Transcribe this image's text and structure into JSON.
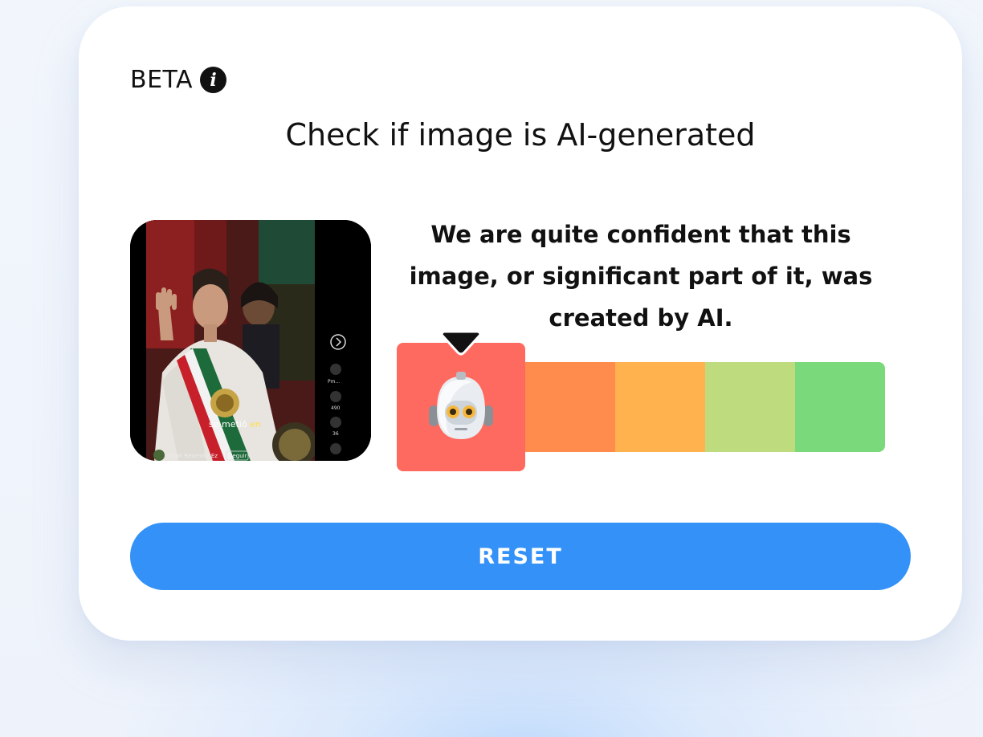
{
  "header": {
    "badge": "BETA",
    "info_icon": "info-icon"
  },
  "title": "Check if image is AI-generated",
  "result": {
    "message": "We are quite confident that this image, or significant part of it, was created by AI.",
    "scale_segments": [
      "#ff6a60",
      "#ff8c4d",
      "#ffb24d",
      "#bedb7e",
      "#7ad97a"
    ],
    "selected_segment": 1,
    "selected_icon": "robot-icon"
  },
  "thumbnail": {
    "caption_white": "se metió ",
    "caption_yellow": "en",
    "username": "Julian Resendiz Ez",
    "follow": "Seguir",
    "side_counts": [
      "Pm...",
      "490",
      "36"
    ]
  },
  "actions": {
    "reset_label": "RESET"
  },
  "colors": {
    "accent": "#3391f7",
    "danger": "#ff6a60"
  }
}
